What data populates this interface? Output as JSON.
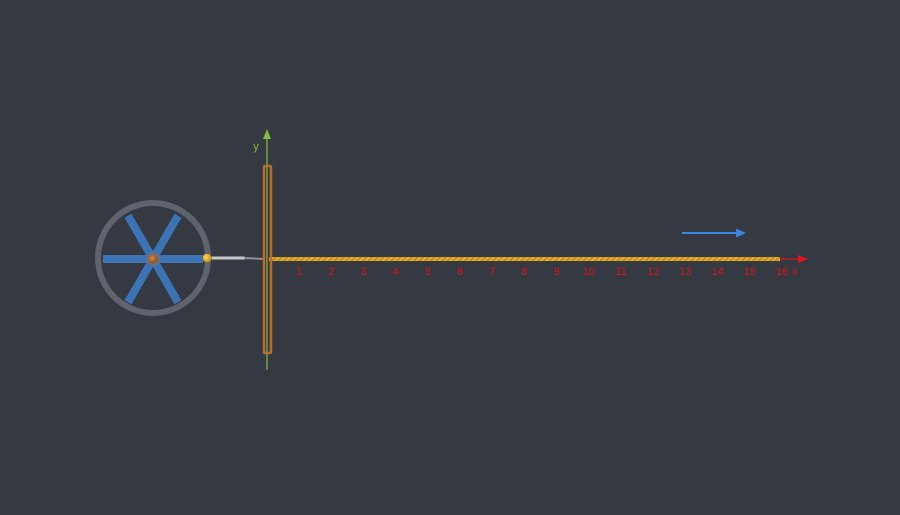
{
  "colors": {
    "background": "#353942",
    "wheel_rim": "#5f636d",
    "wheel_spokes": "#3b73b5",
    "wheel_hub": "#b0672f",
    "crank_pin": "#e0ad27",
    "connecting_rod": "#c6c9cc",
    "slider_frame": "#b86e2a",
    "rope": "#e6ad2f",
    "x_axis": "#e0141b",
    "y_axis": "#7fbf38",
    "direction_arrow": "#3b86e0"
  },
  "axes": {
    "x_label": "x",
    "y_label": "y",
    "x_ticks": [
      "1",
      "2",
      "3",
      "4",
      "5",
      "6",
      "7",
      "8",
      "9",
      "10",
      "11",
      "12",
      "13",
      "14",
      "15",
      "16"
    ]
  },
  "wheel": {
    "spoke_count": 6
  },
  "direction_arrow": {
    "icon": "arrow-right-icon"
  }
}
